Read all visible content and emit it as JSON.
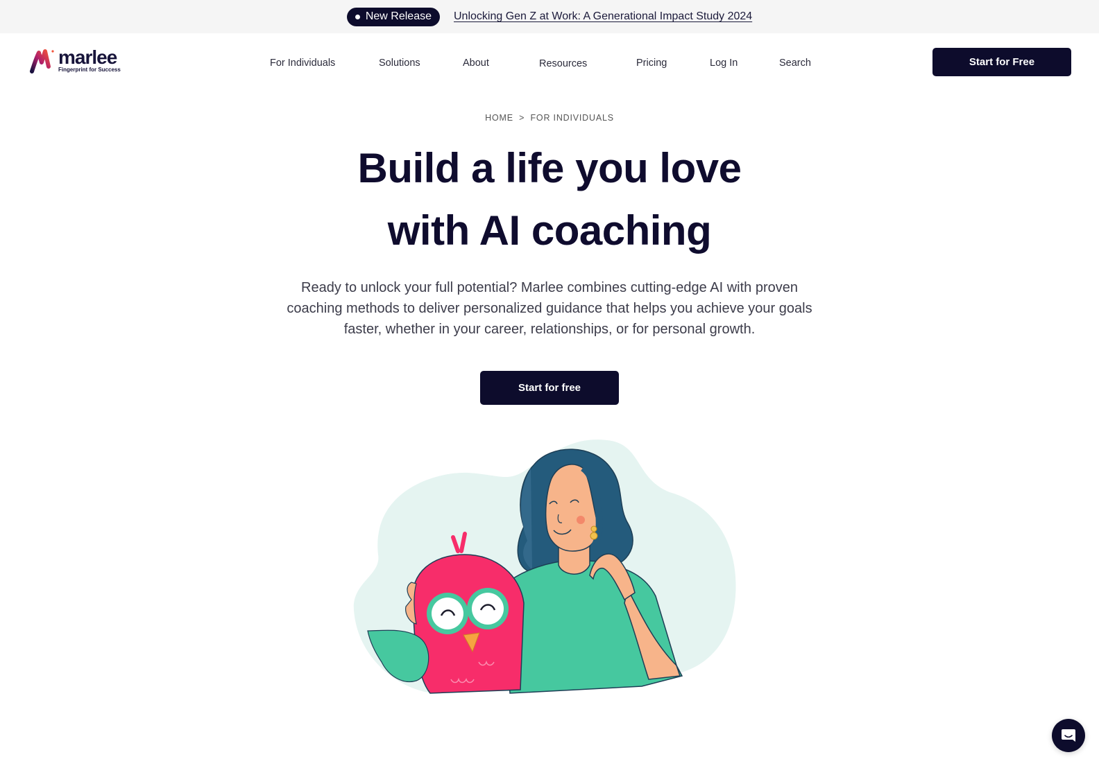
{
  "announcement": {
    "badge_label": "New Release",
    "link_text": "Unlocking Gen Z at Work: A Generational Impact Study 2024"
  },
  "header": {
    "logo": {
      "name": "marlee",
      "tagline": "Fingerprint for Success"
    },
    "nav": [
      {
        "label": "For Individuals"
      },
      {
        "label": "Solutions"
      },
      {
        "label": "About"
      },
      {
        "label": "Resources"
      },
      {
        "label": "Pricing"
      },
      {
        "label": "Log In"
      },
      {
        "label": "Search"
      }
    ],
    "cta_label": "Start for Free"
  },
  "breadcrumb": {
    "items": [
      "HOME",
      "FOR INDIVIDUALS"
    ],
    "separator": ">"
  },
  "hero": {
    "title_line1": "Build a life you love",
    "title_line2": "with AI coaching",
    "subtitle": "Ready to unlock your full potential? Marlee combines cutting-edge AI with proven coaching methods to deliver personalized guidance that helps you achieve your goals faster, whether in your career, relationships, or for personal growth.",
    "cta_label": "Start for free"
  },
  "illustration": {
    "description": "Woman with curly blue hair hugging a pink owl mascot"
  },
  "colors": {
    "brand_dark": "#0d0c2c",
    "owl_pink": "#f72d6a",
    "shirt_green": "#46c89f",
    "hair_blue": "#245b7c",
    "blob_bg": "#e5f4f1"
  },
  "chat": {
    "icon": "chat-bubble-icon"
  }
}
